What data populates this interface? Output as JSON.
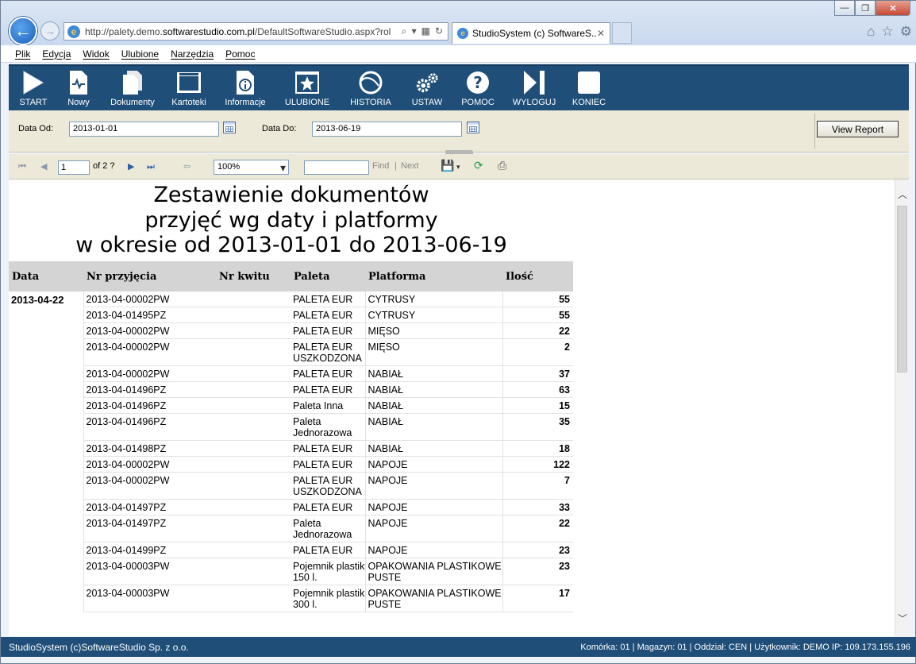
{
  "browser": {
    "url_prefix": "http://palety.demo.",
    "url_domain": "softwarestudio.com.pl",
    "url_suffix": "/DefaultSoftwareStudio.aspx?rol",
    "tab_title": "StudioSystem (c) SoftwareS..."
  },
  "menu": [
    "Plik",
    "Edycja",
    "Widok",
    "Ulubione",
    "Narzędzia",
    "Pomoc"
  ],
  "toolbar": [
    {
      "label": "START",
      "icon": "play-icon"
    },
    {
      "label": "Nowy",
      "icon": "new-document-icon"
    },
    {
      "label": "Dokumenty",
      "icon": "documents-icon"
    },
    {
      "label": "Kartoteki",
      "icon": "window-icon"
    },
    {
      "label": "Informacje",
      "icon": "info-icon"
    },
    {
      "label": "ULUBIONE",
      "icon": "star-icon"
    },
    {
      "label": "HISTORIA",
      "icon": "history-icon"
    },
    {
      "label": "USTAW",
      "icon": "settings-gears-icon"
    },
    {
      "label": "POMOC",
      "icon": "help-icon"
    },
    {
      "label": "WYLOGUJ",
      "icon": "logout-icon"
    },
    {
      "label": "KONIEC",
      "icon": "exit-icon"
    }
  ],
  "params": {
    "date_from_label": "Data Od:",
    "date_from": "2013-01-01",
    "date_to_label": "Data Do:",
    "date_to": "2013-06-19",
    "view_report": "View Report"
  },
  "viewer": {
    "page": "1",
    "of_pages": "of 2 ?",
    "zoom": "100%",
    "find": "Find",
    "sep": "|",
    "next": "Next"
  },
  "report": {
    "title_lines": [
      "Zestawienie dokumentów",
      "przyjęć wg daty i platformy",
      "w okresie od 2013-01-01 do 2013-06-19"
    ],
    "columns": [
      "Data",
      "Nr przyjęcia",
      "Nr kwitu",
      "Paleta",
      "Platforma",
      "Ilość"
    ],
    "date": "2013-04-22",
    "rows": [
      {
        "nr": "2013-04-00002PW",
        "kwit": "",
        "paleta": "PALETA EUR",
        "platforma": "CYTRUSY",
        "ilosc": "55"
      },
      {
        "nr": "2013-04-01495PZ",
        "kwit": "",
        "paleta": "PALETA EUR",
        "platforma": "CYTRUSY",
        "ilosc": "55"
      },
      {
        "nr": "2013-04-00002PW",
        "kwit": "",
        "paleta": "PALETA EUR",
        "platforma": "MIĘSO",
        "ilosc": "22"
      },
      {
        "nr": "2013-04-00002PW",
        "kwit": "",
        "paleta": "PALETA EUR USZKODZONA",
        "platforma": "MIĘSO",
        "ilosc": "2"
      },
      {
        "nr": "2013-04-00002PW",
        "kwit": "",
        "paleta": "PALETA EUR",
        "platforma": "NABIAŁ",
        "ilosc": "37"
      },
      {
        "nr": "2013-04-01496PZ",
        "kwit": "",
        "paleta": "PALETA EUR",
        "platforma": "NABIAŁ",
        "ilosc": "63"
      },
      {
        "nr": "2013-04-01496PZ",
        "kwit": "",
        "paleta": "Paleta Inna",
        "platforma": "NABIAŁ",
        "ilosc": "15"
      },
      {
        "nr": "2013-04-01496PZ",
        "kwit": "",
        "paleta": "Paleta Jednorazowa",
        "platforma": "NABIAŁ",
        "ilosc": "35"
      },
      {
        "nr": "2013-04-01498PZ",
        "kwit": "",
        "paleta": "PALETA EUR",
        "platforma": "NABIAŁ",
        "ilosc": "18"
      },
      {
        "nr": "2013-04-00002PW",
        "kwit": "",
        "paleta": "PALETA EUR",
        "platforma": "NAPOJE",
        "ilosc": "122"
      },
      {
        "nr": "2013-04-00002PW",
        "kwit": "",
        "paleta": "PALETA EUR USZKODZONA",
        "platforma": "NAPOJE",
        "ilosc": "7"
      },
      {
        "nr": "2013-04-01497PZ",
        "kwit": "",
        "paleta": "PALETA EUR",
        "platforma": "NAPOJE",
        "ilosc": "33"
      },
      {
        "nr": "2013-04-01497PZ",
        "kwit": "",
        "paleta": "Paleta Jednorazowa",
        "platforma": "NAPOJE",
        "ilosc": "22"
      },
      {
        "nr": "2013-04-01499PZ",
        "kwit": "",
        "paleta": "PALETA EUR",
        "platforma": "NAPOJE",
        "ilosc": "23"
      },
      {
        "nr": "2013-04-00003PW",
        "kwit": "",
        "paleta": "Pojemnik plastik 150 l.",
        "platforma": "OPAKOWANIA PLASTIKOWE PUSTE",
        "ilosc": "23"
      },
      {
        "nr": "2013-04-00003PW",
        "kwit": "",
        "paleta": "Pojemnik plastik 300 l.",
        "platforma": "OPAKOWANIA PLASTIKOWE PUSTE",
        "ilosc": "17"
      }
    ]
  },
  "footer": {
    "left": "StudioSystem (c)SoftwareStudio Sp. z o.o.",
    "right": "Komórka: 01 | Magazyn: 01 | Oddział: CEN | Użytkownik: DEMO IP: 109.173.155.196"
  },
  "colors": {
    "toolbar_bg": "#1f4e78",
    "param_bg": "#ece9d8",
    "header_bg": "#d4d4d4"
  }
}
